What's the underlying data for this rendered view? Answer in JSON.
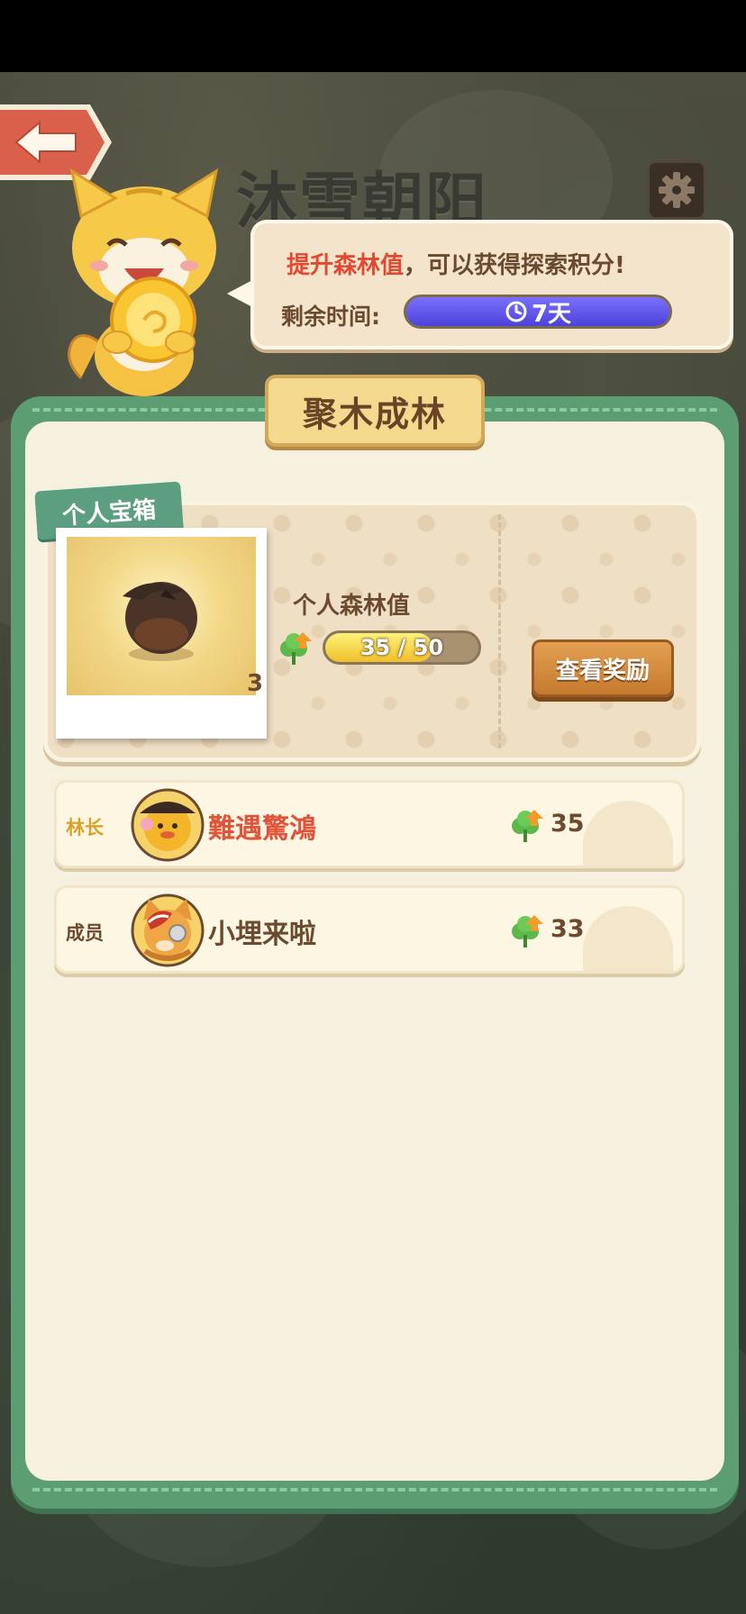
{
  "header": {
    "title": "沐雪朝阳"
  },
  "bubble": {
    "highlight": "提升森林值",
    "message": "，可以获得探索积分!",
    "remain_label": "剩余时间:",
    "remain_value": "7天",
    "remain_fill": 1.0
  },
  "panel": {
    "title": "聚木成林"
  },
  "chest": {
    "tag": "个人宝箱",
    "count": "3",
    "forest_label": "个人森林值",
    "forest_value": "35 / 50",
    "forest_current": 35,
    "forest_max": 50,
    "view_button": "查看奖励"
  },
  "members": [
    {
      "role": "林长",
      "name": "難遇驚鴻",
      "score": "35",
      "role_color": "#d9a22a",
      "name_color": "#e0543a"
    },
    {
      "role": "成员",
      "name": "小埋来啦",
      "score": "33",
      "role_color": "#6b4a30",
      "name_color": "#6b4a30"
    }
  ],
  "colors": {
    "panel_green": "#5c9e72",
    "timer_blue": "#4c42d8",
    "progress_yellow": "#f0c02a",
    "button_orange": "#c67a2e"
  }
}
